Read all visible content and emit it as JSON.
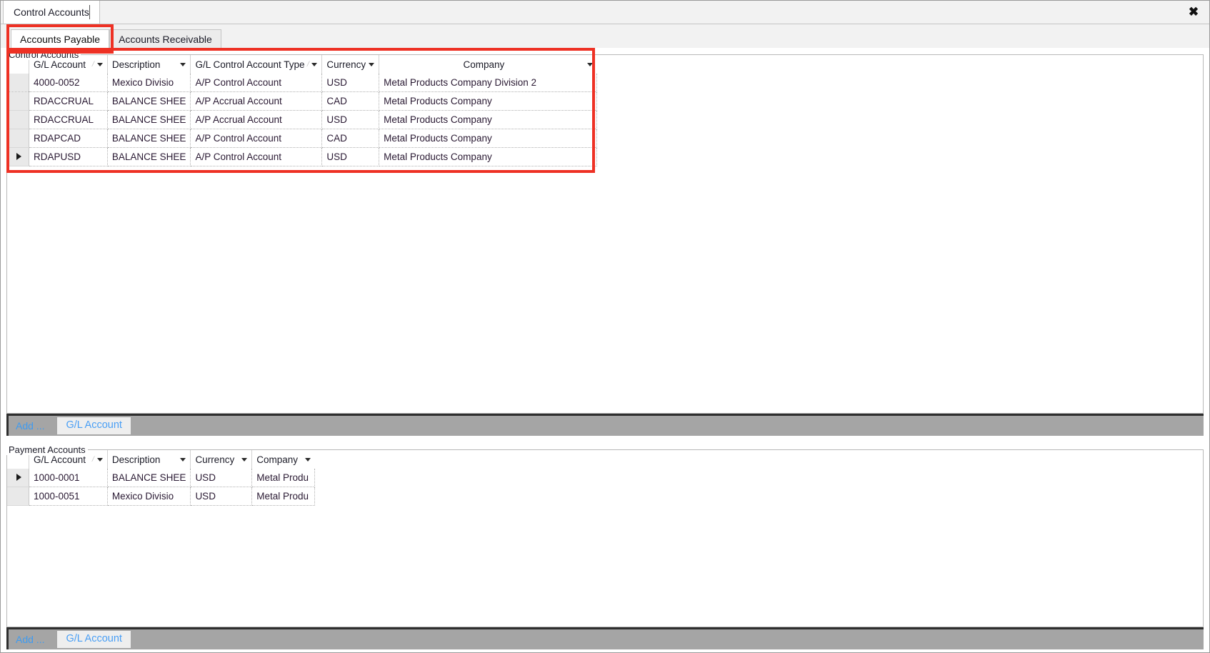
{
  "window": {
    "document_tab": "Control Accounts",
    "close_icon": "close-icon"
  },
  "inner_tabs": [
    {
      "label": "Accounts Payable",
      "active": true
    },
    {
      "label": "Accounts Receivable",
      "active": false
    }
  ],
  "highlight_color": "#ee3124",
  "accent_color": "#4a9ff5",
  "control_accounts": {
    "caption": "Control Accounts",
    "columns": [
      {
        "label": "G/L Account",
        "sort": true,
        "filter": true
      },
      {
        "label": "Description",
        "sort": false,
        "filter": true
      },
      {
        "label": "G/L Control Account Type",
        "sort": true,
        "filter": true
      },
      {
        "label": "Currency",
        "sort": false,
        "filter": true
      },
      {
        "label": "Company",
        "sort": false,
        "filter": true
      }
    ],
    "rows": [
      {
        "selected": false,
        "gl_account": "4000-0052",
        "description": "Mexico Divisio",
        "type": "A/P Control Account",
        "currency": "USD",
        "company": "Metal Products Company Division 2"
      },
      {
        "selected": false,
        "gl_account": "RDACCRUAL",
        "description": "BALANCE SHEE",
        "type": "A/P Accrual Account",
        "currency": "CAD",
        "company": "Metal Products Company"
      },
      {
        "selected": false,
        "gl_account": "RDACCRUAL",
        "description": "BALANCE SHEE",
        "type": "A/P Accrual Account",
        "currency": "USD",
        "company": "Metal Products Company"
      },
      {
        "selected": false,
        "gl_account": "RDAPCAD",
        "description": "BALANCE SHEE",
        "type": "A/P Control Account",
        "currency": "CAD",
        "company": "Metal Products Company"
      },
      {
        "selected": true,
        "gl_account": "RDAPUSD",
        "description": "BALANCE SHEE",
        "type": "A/P Control Account",
        "currency": "USD",
        "company": "Metal Products Company"
      }
    ],
    "addbar": {
      "add_label": "Add ...",
      "chip_label": "G/L Account"
    }
  },
  "payment_accounts": {
    "caption": "Payment Accounts",
    "columns": [
      {
        "label": "G/L Account",
        "sort": true,
        "filter": true
      },
      {
        "label": "Description",
        "sort": false,
        "filter": true
      },
      {
        "label": "Currency",
        "sort": false,
        "filter": true
      },
      {
        "label": "Company",
        "sort": false,
        "filter": true
      }
    ],
    "rows": [
      {
        "selected": true,
        "gl_account": "1000-0001",
        "description": "BALANCE SHEE",
        "currency": "USD",
        "company": "Metal Produ"
      },
      {
        "selected": false,
        "gl_account": "1000-0051",
        "description": "Mexico Divisio",
        "currency": "USD",
        "company": "Metal Produ"
      }
    ],
    "addbar": {
      "add_label": "Add ...",
      "chip_label": "G/L Account"
    }
  }
}
